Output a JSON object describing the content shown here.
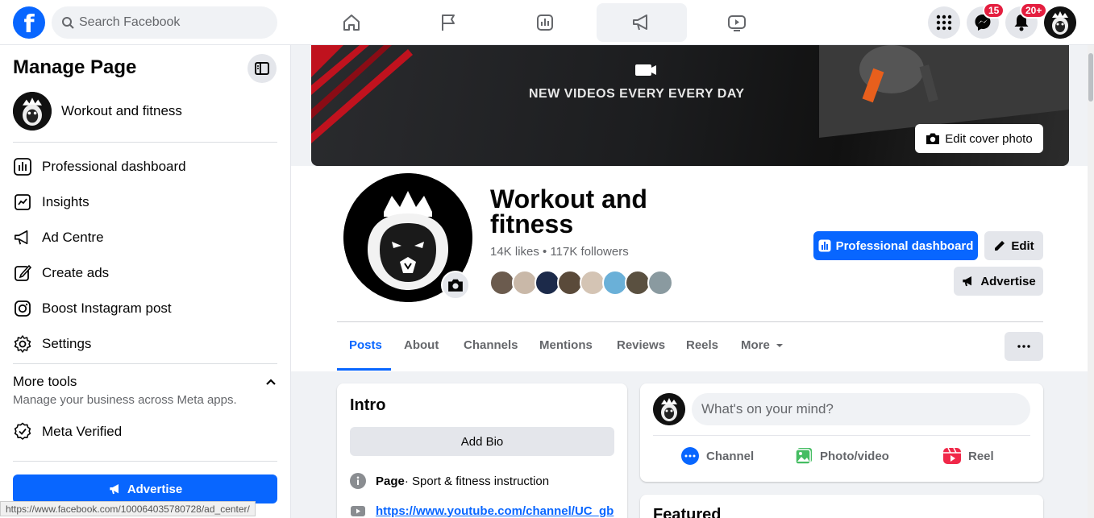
{
  "topbar": {
    "logo": "f",
    "search_placeholder": "Search Facebook",
    "messenger_badge": "15",
    "notifications_badge": "20+"
  },
  "sidebar": {
    "title": "Manage Page",
    "page_name": "Workout and fitness",
    "items": [
      {
        "label": "Professional dashboard",
        "icon": "dashboard-icon"
      },
      {
        "label": "Insights",
        "icon": "insights-icon"
      },
      {
        "label": "Ad Centre",
        "icon": "megaphone-icon"
      },
      {
        "label": "Create ads",
        "icon": "pencil-square-icon"
      },
      {
        "label": "Boost Instagram post",
        "icon": "instagram-icon"
      },
      {
        "label": "Settings",
        "icon": "gear-icon"
      }
    ],
    "more_tools_title": "More tools",
    "more_tools_sub": "Manage your business across Meta apps.",
    "meta_verified": "Meta Verified",
    "advertise_label": "Advertise",
    "status_url": "https://www.facebook.com/100064035780728/ad_center/"
  },
  "cover": {
    "banner_text": "NEW VIDEOS EVERY EVERY DAY",
    "edit_cover_label": "Edit cover photo"
  },
  "profile": {
    "name": "Workout and fitness",
    "stats": "14K likes • 117K followers",
    "dashboard_label": "Professional dashboard",
    "edit_label": "Edit",
    "advertise_label": "Advertise",
    "face_colors": [
      "#6b5b4e",
      "#c9b8a8",
      "#1c2a4a",
      "#5a4a3a",
      "#d4c4b4",
      "#6ab0d8",
      "#5a5040",
      "#8a9aa0"
    ]
  },
  "tabs": [
    {
      "label": "Posts",
      "active": true
    },
    {
      "label": "About"
    },
    {
      "label": "Channels"
    },
    {
      "label": "Mentions"
    },
    {
      "label": "Reviews"
    },
    {
      "label": "Reels"
    },
    {
      "label": "More"
    }
  ],
  "intro": {
    "title": "Intro",
    "add_bio": "Add Bio",
    "category_bold": "Page",
    "category_rest": " · Sport & fitness instruction",
    "link": "https://www.youtube.com/channel/UC_gb"
  },
  "composer": {
    "placeholder": "What's on your mind?",
    "actions": [
      "Channel",
      "Photo/video",
      "Reel"
    ]
  },
  "featured": {
    "title": "Featured"
  },
  "colors": {
    "accent": "#0866ff",
    "badge": "#e41e3f"
  }
}
